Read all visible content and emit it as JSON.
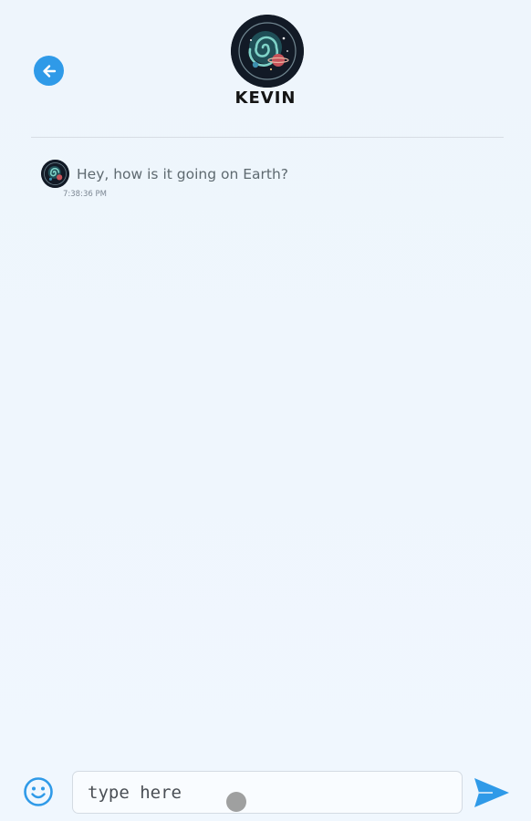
{
  "header": {
    "contact_name": "KEVIN",
    "avatar_icon": "galaxy-avatar-icon",
    "back_icon": "arrow-left-icon"
  },
  "messages": [
    {
      "text": "Hey, how is it going on Earth?",
      "time": "7:38:36 PM"
    }
  ],
  "composer": {
    "placeholder": "type here",
    "emoji_icon": "smiley-icon",
    "send_icon": "send-arrow-icon"
  },
  "colors": {
    "accent": "#2f9ae8",
    "background": "#f0f7fe",
    "message_text": "#5e6a70"
  }
}
